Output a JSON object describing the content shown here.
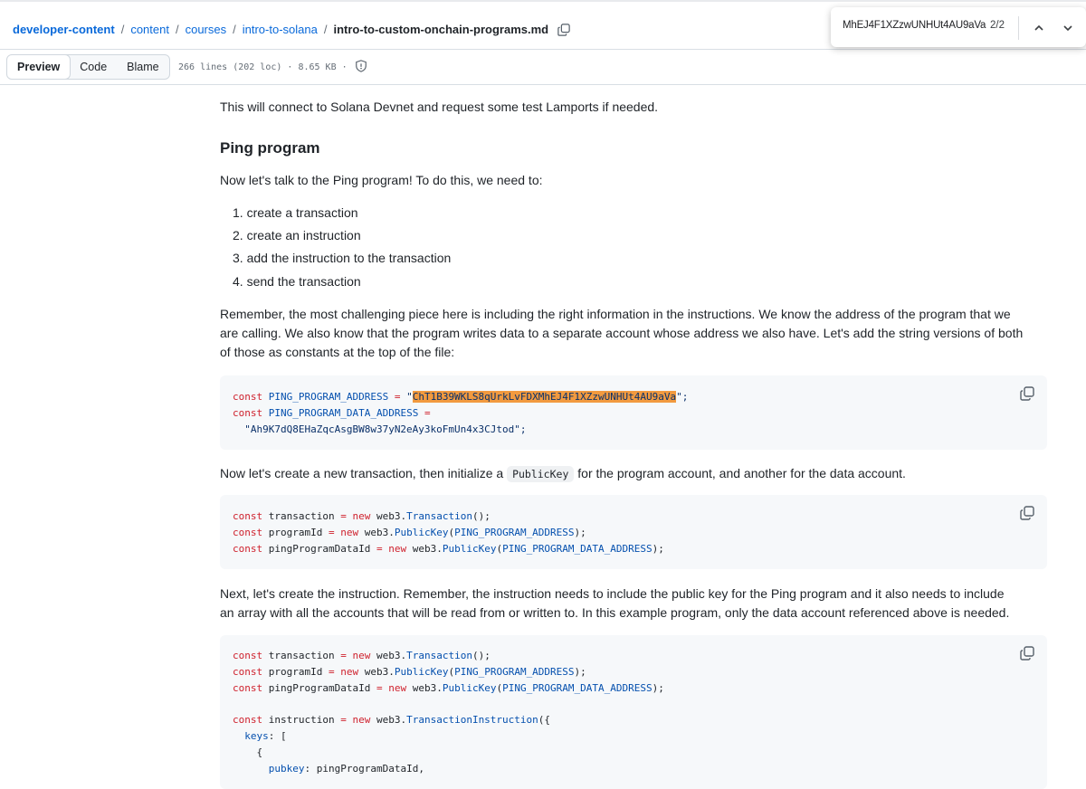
{
  "breadcrumb": {
    "parts": [
      "developer-content",
      "content",
      "courses",
      "intro-to-solana"
    ],
    "current": "intro-to-custom-onchain-programs.md"
  },
  "find": {
    "query": "MhEJ4F1XZzwUNHUt4AU9aVa",
    "count": "2/2"
  },
  "toolbar": {
    "tabs": [
      "Preview",
      "Code",
      "Blame"
    ],
    "file_info": "266 lines (202 loc) · 8.65 KB ·"
  },
  "content": {
    "p1": "This will connect to Solana Devnet and request some test Lamports if needed.",
    "h_ping": "Ping program",
    "p2": "Now let's talk to the Ping program! To do this, we need to:",
    "list": [
      "1. create a transaction",
      "2. create an instruction",
      "3. add the instruction to the transaction",
      "4. send the transaction"
    ],
    "p3_lines": [
      "Remember, the most challenging piece here is including the right information in the instructions. We know the address of the program that we",
      "are calling. We also know that the program writes data to a separate account whose address we also have. Let's add the string versions of both",
      "of those as constants at the top of the file:"
    ],
    "code1": {
      "l1_pre": "const PING_PROGRAM_ADDRESS = ",
      "l1_quote": "\"",
      "l1_hl": "ChT1B39WKLS8qUrkLvFDXMhEJ4F1XZzwUNHUt4AU9aVa",
      "l1_post": "\";",
      "l2": "const PING_PROGRAM_DATA_ADDRESS =",
      "l3": "\"Ah9K7dQ8EHaZqcAsgBW8w37yN2eAy3koFmUn4x3CJtod\";"
    },
    "p4_pre": "Now let's create a new transaction, then initialize a",
    "p4_code": "PublicKey",
    "p4_post": "for the program account, and another for the data account.",
    "code2": [
      "const transaction = new web3.Transaction();",
      "const programId = new web3.PublicKey(PING_PROGRAM_ADDRESS);",
      "const pingProgramDataId = new web3.PublicKey(PING_PROGRAM_DATA_ADDRESS);"
    ],
    "p5_lines": [
      "Next, let's create the instruction. Remember, the instruction needs to include the public key for the Ping program and it also needs to include",
      "an array with all the accounts that will be read from or written to. In this example program, only the data account referenced above is needed."
    ],
    "code3": [
      "const transaction = new web3.Transaction();",
      "const programId = new web3.PublicKey(PING_PROGRAM_ADDRESS);",
      "const pingProgramDataId = new web3.PublicKey(PING_PROGRAM_DATA_ADDRESS);",
      "",
      "const instruction = new web3.TransactionInstruction({",
      "  keys: [",
      "    {",
      "      pubkey: pingProgramDataId,"
    ]
  }
}
